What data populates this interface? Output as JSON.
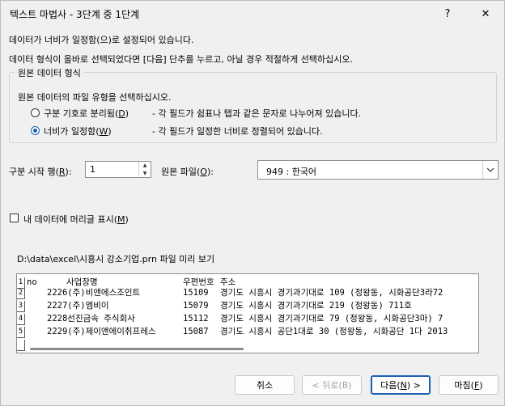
{
  "window": {
    "title": "텍스트 마법사 - 3단계 중 1단계",
    "help_glyph": "?",
    "close_glyph": "✕"
  },
  "intro": {
    "line1": "데이터가 너비가 일정함(으)로 설정되어 있습니다.",
    "line2": "데이터 형식이 올바로 선택되었다면 [다음] 단추를 누르고, 아닐 경우 적절하게 선택하십시오."
  },
  "source_format": {
    "legend": "원본 데이터 형식",
    "prompt": "원본 데이터의 파일 유형을 선택하십시오.",
    "options": [
      {
        "label": "구분 기호로 분리됨(",
        "hotkey": "D",
        "label_end": ")",
        "description": "- 각 필드가 쉼표나 탭과 같은 문자로 나누어져 있습니다.",
        "selected": false
      },
      {
        "label": "너비가 일정함(",
        "hotkey": "W",
        "label_end": ")",
        "description": "- 각 필드가 일정한 너비로 정렬되어 있습니다.",
        "selected": true
      }
    ]
  },
  "start_row": {
    "label_pre": "구분 시작 행(",
    "hotkey": "R",
    "label_post": "):",
    "value": "1"
  },
  "file_origin": {
    "label_pre": "원본 파일(",
    "hotkey": "O",
    "label_post": "):",
    "value": "949 : 한국어"
  },
  "headers_checkbox": {
    "label_pre": "내 데이터에 머리글 표시(",
    "hotkey": "M",
    "label_post": ")",
    "checked": false
  },
  "preview": {
    "caption": "D:\\data\\excel\\시흥시 강소기업.prn 파일 미리 보기",
    "rows": [
      {
        "num": "1",
        "no": "no",
        "name": "사업장명",
        "zip": "우편번호",
        "addr": "주소"
      },
      {
        "num": "2",
        "no": "",
        "name": "2226(주)비앤에스조인트",
        "zip": "15109",
        "addr": "경기도 시흥시 경기과기대로 109 (정왕동, 시화공단3라72"
      },
      {
        "num": "3",
        "no": "",
        "name": "2227(주)엠비이",
        "zip": "15079",
        "addr": "경기도 시흥시 경기과기대로 219 (정왕동) 711호"
      },
      {
        "num": "4",
        "no": "",
        "name": "2228선진금속 주식회사",
        "zip": "15112",
        "addr": "경기도 시흥시 경기과기대로 79 (정왕동, 시화공단3마) 7"
      },
      {
        "num": "5",
        "no": "",
        "name": "2229(주)제이앤에이취프레스",
        "zip": "15087",
        "addr": "경기도 시흥시 공단1대로 30 (정왕동, 시화공단 1다 2013"
      }
    ]
  },
  "buttons": {
    "cancel": "취소",
    "back": "< 뒤로(B)",
    "next_pre": "다음(",
    "next_hotkey": "N",
    "next_post": ") >",
    "finish_pre": "마침(",
    "finish_hotkey": "F",
    "finish_post": ")"
  },
  "colors": {
    "accent": "#1a5fb4",
    "background": "#f0f0f0"
  }
}
